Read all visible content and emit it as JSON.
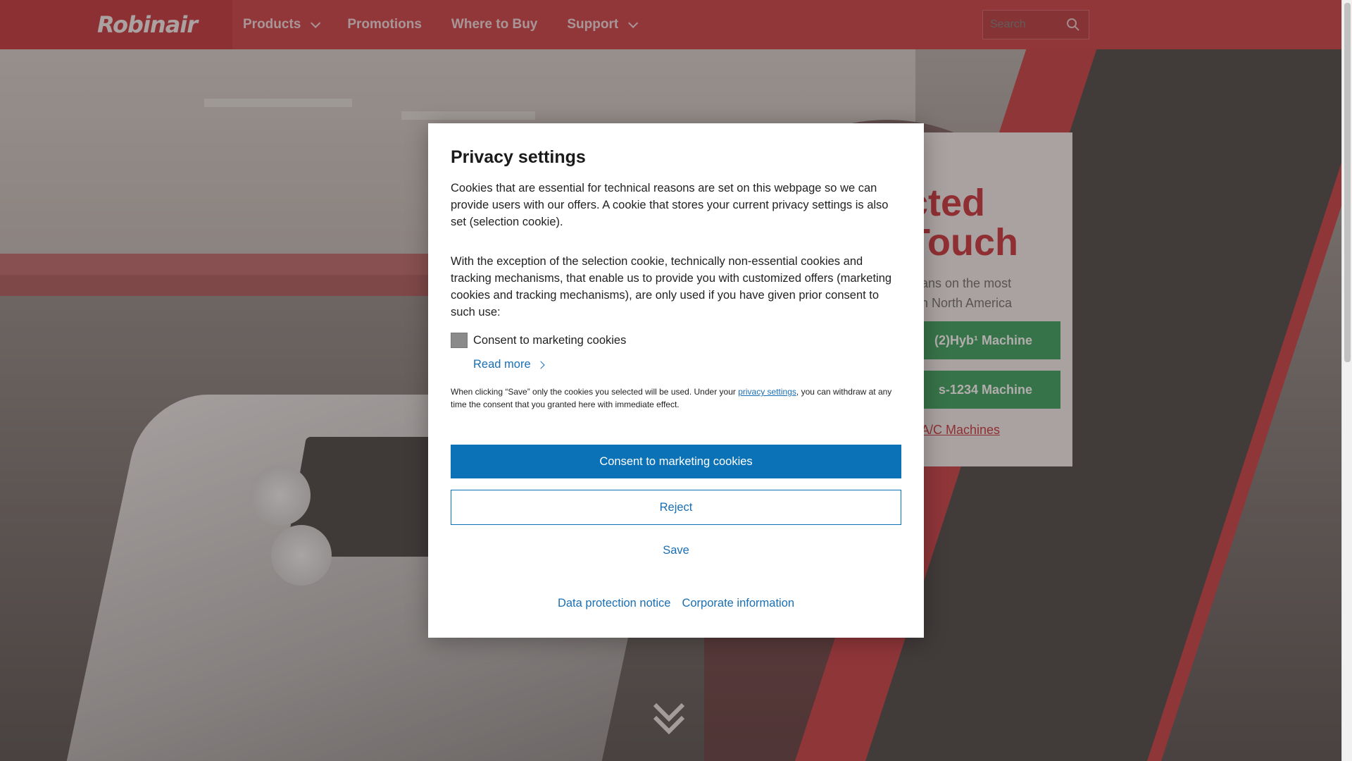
{
  "header": {
    "logo_text": "Robinair",
    "nav": [
      {
        "label": "Products",
        "has_dropdown": true
      },
      {
        "label": "Promotions",
        "has_dropdown": false
      },
      {
        "label": "Where to Buy",
        "has_dropdown": false
      },
      {
        "label": "Support",
        "has_dropdown": true
      }
    ],
    "search_placeholder": "Search"
  },
  "hero": {
    "promo_title_line1": "cted",
    "promo_title_line2": "Touch",
    "promo_text_line1": "ians on the most",
    "promo_text_line2": "in North America",
    "promo_btn1": "(2)Hyb¹ Machine",
    "promo_btn2": "s-1234 Machine",
    "promo_link": "A/C Machines"
  },
  "modal": {
    "title": "Privacy settings",
    "paragraph1": "Cookies that are essential for technical reasons are set on this webpage so we can provide users with our offers. A cookie that stores your current privacy settings is also set (selection cookie).",
    "paragraph2": "With the exception of the selection cookie, technically non-essential cookies and tracking mechanisms, that enable us to provide you with customized offers (marketing cookies and tracking mechanisms), are only used if you have given prior consent to such use:",
    "checkbox_label": "Consent to marketing cookies",
    "read_more": "Read more",
    "note_before": "When clicking “Save” only the cookies you selected will be used. Under your ",
    "note_link": "privacy settings",
    "note_after": ", you can withdraw at any time the consent that you granted here with immediate effect.",
    "btn_consent": "Consent to marketing cookies",
    "btn_reject": "Reject",
    "btn_save": "Save",
    "link_data_protection": "Data protection notice",
    "link_corporate": "Corporate information"
  },
  "colors": {
    "brand_red": "#c9343a",
    "primary_blue": "#0c72b8",
    "link_blue": "#1a6fb3",
    "promo_green": "#2e9b52"
  }
}
